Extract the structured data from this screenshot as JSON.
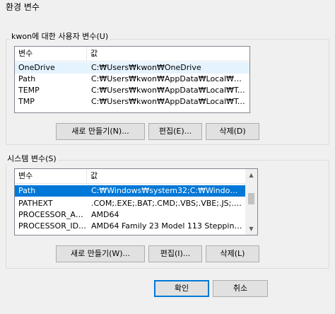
{
  "window": {
    "title": "환경 변수"
  },
  "user_vars": {
    "group_label": "kwon에 대한 사용자 변수(U)",
    "columns": [
      "변수",
      "값"
    ],
    "rows": [
      {
        "name": "OneDrive",
        "value": "C:₩Users₩kwon₩OneDrive"
      },
      {
        "name": "Path",
        "value": "C:₩Users₩kwon₩AppData₩Local₩Microso..."
      },
      {
        "name": "TEMP",
        "value": "C:₩Users₩kwon₩AppData₩Local₩Temp"
      },
      {
        "name": "TMP",
        "value": "C:₩Users₩kwon₩AppData₩Local₩Temp"
      }
    ],
    "buttons": {
      "new": "새로 만들기(N)...",
      "edit": "편집(E)...",
      "delete": "삭제(D)"
    }
  },
  "system_vars": {
    "group_label": "시스템 변수(S)",
    "columns": [
      "변수",
      "값"
    ],
    "rows": [
      {
        "name": "Path",
        "value": "C:₩Windows₩system32;C:₩Windows;C:₩..."
      },
      {
        "name": "PATHEXT",
        "value": ".COM;.EXE;.BAT;.CMD;.VBS;.VBE;.JS;.JSE;.W..."
      },
      {
        "name": "PROCESSOR_ARC...",
        "value": "AMD64"
      },
      {
        "name": "PROCESSOR_IDEN...",
        "value": "AMD64 Family 23 Model 113 Stepping 0, ..."
      }
    ],
    "buttons": {
      "new": "새로 만들기(W)...",
      "edit": "편집(I)...",
      "delete": "삭제(L)"
    }
  },
  "footer": {
    "ok": "확인",
    "cancel": "취소"
  },
  "icons": {
    "scroll_up": "scroll-up-arrow-icon",
    "scroll_down": "scroll-down-arrow-icon"
  },
  "colors": {
    "selection": "#0078d7",
    "hover": "#e5f3ff",
    "default_button_border": "#0078d7"
  }
}
